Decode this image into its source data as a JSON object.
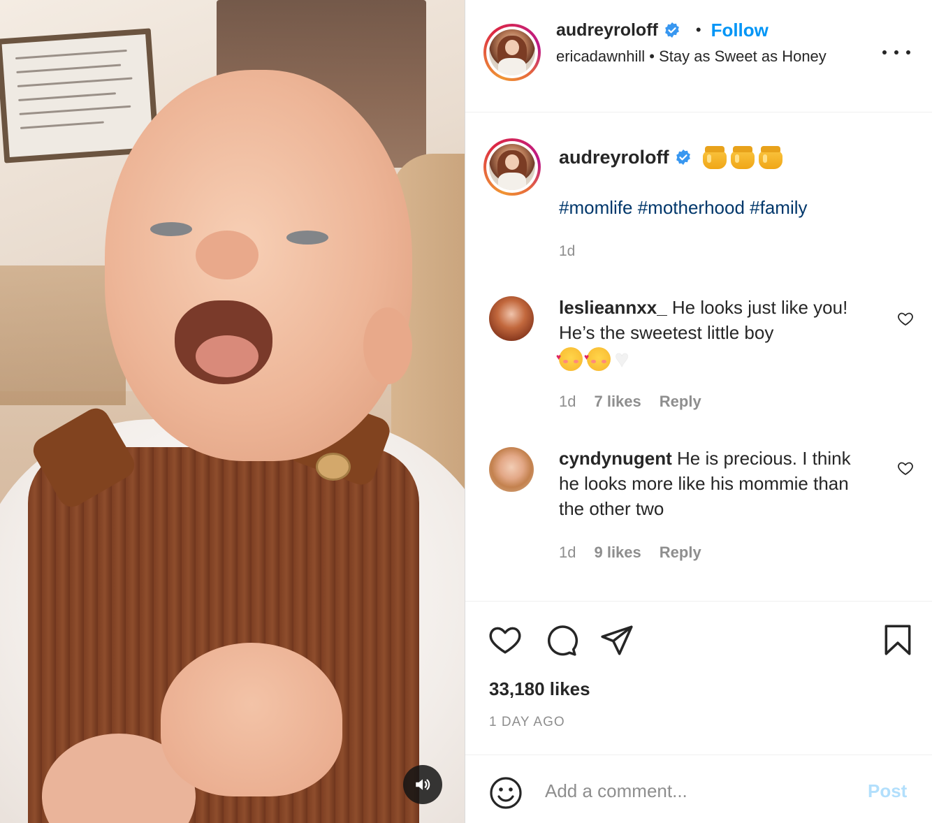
{
  "header": {
    "username": "audreyroloff",
    "follow_label": "Follow",
    "audio_text": "ericadawnhill • Stay as Sweet as Honey",
    "more_icon": "more-horizontal-icon",
    "verified_icon": "verified-badge-icon"
  },
  "caption": {
    "username": "audreyroloff",
    "emoji": [
      "honey-pot-emoji",
      "honey-pot-emoji",
      "honey-pot-emoji"
    ],
    "hashtags": "#momlife #motherhood #family",
    "time": "1d"
  },
  "comments": [
    {
      "username": "leslieannxx_",
      "text": " He looks just like you! He’s the sweetest little boy",
      "emoji": [
        "smiling-face-with-hearts-emoji",
        "smiling-face-with-hearts-emoji",
        "white-heart-emoji"
      ],
      "time": "1d",
      "likes": "7 likes",
      "reply": "Reply"
    },
    {
      "username": "cyndynugent",
      "text": " He is precious. I think he looks more like his mommie than the other two",
      "time": "1d",
      "likes": "9 likes",
      "reply": "Reply"
    }
  ],
  "actions": {
    "icons": [
      "heart-icon",
      "comment-icon",
      "share-icon",
      "bookmark-icon"
    ],
    "likes": "33,180 likes",
    "ago": "1 DAY AGO"
  },
  "add_comment": {
    "placeholder": "Add a comment...",
    "post_label": "Post"
  },
  "media": {
    "sound_icon": "speaker-icon"
  },
  "colors": {
    "link_blue": "#0095f6",
    "hashtag_blue": "#00376b",
    "post_disabled": "#b2dffc",
    "meta_grey": "#8e8e8e"
  }
}
